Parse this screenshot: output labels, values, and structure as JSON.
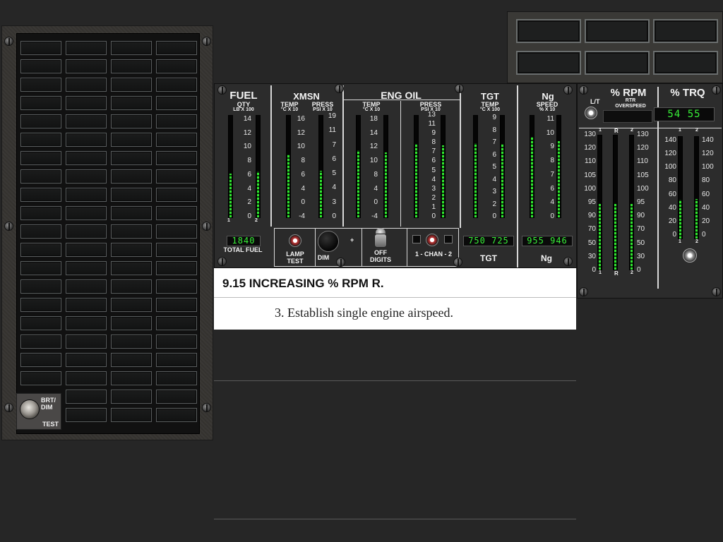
{
  "caution_panel": {
    "brt_dim_label": "BRT/\nDIM",
    "test_label": "TEST",
    "rows": 21,
    "cols": 4
  },
  "fuel": {
    "title": "FUEL",
    "sub": "QTY",
    "units": "LB X 100",
    "scale": [
      "14",
      "12",
      "10",
      "8",
      "6",
      "4",
      "2",
      "0"
    ],
    "bar1": 0.43,
    "bar2": 0.45,
    "digits": "1840",
    "total_label": "TOTAL FUEL"
  },
  "xmsn": {
    "title": "XMSN",
    "temp_label": "TEMP",
    "temp_units": "°C X 10",
    "press_label": "PRESS",
    "press_units": "PSI X 10",
    "temp_scale": [
      "16",
      "12",
      "10",
      "8",
      "6",
      "4",
      "0",
      "-4"
    ],
    "press_scale": [
      "19",
      "11",
      "7",
      "6",
      "5",
      "4",
      "3",
      "0"
    ],
    "temp_bar": 0.62,
    "press_bar": 0.46
  },
  "eng_oil": {
    "title": "ENG OIL",
    "temp_label": "TEMP",
    "temp_units": "°C X 10",
    "press_label": "PRESS",
    "press_units": "PSI X 10",
    "temp_scale": [
      "18",
      "14",
      "12",
      "10",
      "8",
      "4",
      "0",
      "-4"
    ],
    "press_scale": [
      "13",
      "11",
      "9",
      "8",
      "7",
      "6",
      "5",
      "4",
      "3",
      "2",
      "1",
      "0"
    ],
    "temp_bar": 0.66,
    "temp_bar2": 0.64,
    "press_bar": 0.72,
    "press_bar2": 0.71
  },
  "tgt": {
    "title": "TGT",
    "temp_label": "TEMP",
    "temp_units": "°C X 100",
    "scale": [
      "9",
      "8",
      "7",
      "6",
      "5",
      "4",
      "3",
      "2",
      "0"
    ],
    "bar1": 0.73,
    "bar2": 0.72,
    "digits": "750 725",
    "bottom_label": "TGT"
  },
  "ng": {
    "title": "Ng",
    "speed_label": "SPEED",
    "speed_units": "% X 10",
    "scale": [
      "11",
      "10",
      "9",
      "8",
      "7",
      "6",
      "4",
      "0"
    ],
    "bar1": 0.79,
    "bar2": 0.75,
    "digits": "955 946",
    "bottom_label": "Ng"
  },
  "controls": {
    "lamp_test": "LAMP\nTEST",
    "dim": "DIM",
    "plus": "+",
    "off": "OFF",
    "digits": "DIGITS",
    "chan": "1 - CHAN - 2"
  },
  "rpm": {
    "title": "% RPM",
    "lt": "L/T",
    "rtr": "RTR",
    "overspeed": "OVERSPEED",
    "scale_left": [
      "130",
      "120",
      "110",
      "105",
      "100",
      "95",
      "90",
      "70",
      "50",
      "30",
      "0"
    ],
    "scale_right": [
      "130",
      "120",
      "110",
      "105",
      "100",
      "95",
      "90",
      "70",
      "50",
      "30",
      "0"
    ],
    "col_labels_top": [
      "1",
      "R",
      "2"
    ],
    "col_labels_bottom": [
      "1",
      "R",
      "2"
    ],
    "bar_1": 0.49,
    "bar_R": 0.49,
    "bar_2": 0.49
  },
  "trq": {
    "title": "% TRQ",
    "digits": "54  55",
    "scale_left": [
      "140",
      "120",
      "100",
      "80",
      "60",
      "40",
      "20",
      "0"
    ],
    "scale_right": [
      "140",
      "120",
      "100",
      "80",
      "60",
      "40",
      "20",
      "0"
    ],
    "col_labels": [
      "1",
      "2"
    ],
    "bar_1": 0.38,
    "bar_2": 0.39
  },
  "procedure": {
    "title": "9.15  INCREASING % RPM R.",
    "step": "3.  Establish single engine airspeed."
  }
}
